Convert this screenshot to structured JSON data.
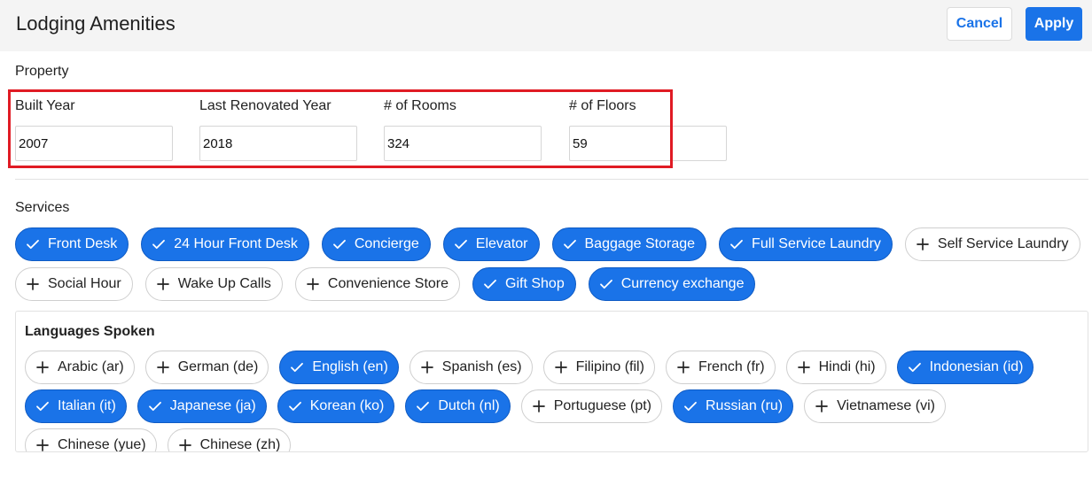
{
  "header": {
    "title": "Lodging Amenities",
    "cancel_label": "Cancel",
    "apply_label": "Apply"
  },
  "property": {
    "section_label": "Property",
    "fields": [
      {
        "label": "Built Year",
        "value": "2007"
      },
      {
        "label": "Last Renovated Year",
        "value": "2018"
      },
      {
        "label": "# of Rooms",
        "value": "324"
      },
      {
        "label": "# of Floors",
        "value": "59"
      }
    ]
  },
  "services": {
    "section_label": "Services",
    "chips": [
      {
        "label": "Front Desk",
        "selected": true
      },
      {
        "label": "24 Hour Front Desk",
        "selected": true
      },
      {
        "label": "Concierge",
        "selected": true
      },
      {
        "label": "Elevator",
        "selected": true
      },
      {
        "label": "Baggage Storage",
        "selected": true
      },
      {
        "label": "Full Service Laundry",
        "selected": true
      },
      {
        "label": "Self Service Laundry",
        "selected": false
      },
      {
        "label": "Social Hour",
        "selected": false
      },
      {
        "label": "Wake Up Calls",
        "selected": false
      },
      {
        "label": "Convenience Store",
        "selected": false
      },
      {
        "label": "Gift Shop",
        "selected": true
      },
      {
        "label": "Currency exchange",
        "selected": true
      }
    ]
  },
  "languages": {
    "section_label": "Languages Spoken",
    "chips": [
      {
        "label": "Arabic (ar)",
        "selected": false
      },
      {
        "label": "German (de)",
        "selected": false
      },
      {
        "label": "English (en)",
        "selected": true
      },
      {
        "label": "Spanish (es)",
        "selected": false
      },
      {
        "label": "Filipino (fil)",
        "selected": false
      },
      {
        "label": "French (fr)",
        "selected": false
      },
      {
        "label": "Hindi (hi)",
        "selected": false
      },
      {
        "label": "Indonesian (id)",
        "selected": true
      },
      {
        "label": "Italian (it)",
        "selected": true
      },
      {
        "label": "Japanese (ja)",
        "selected": true
      },
      {
        "label": "Korean (ko)",
        "selected": true
      },
      {
        "label": "Dutch (nl)",
        "selected": true
      },
      {
        "label": "Portuguese (pt)",
        "selected": false
      },
      {
        "label": "Russian (ru)",
        "selected": true
      },
      {
        "label": "Vietnamese (vi)",
        "selected": false
      },
      {
        "label": "Chinese (yue)",
        "selected": false
      },
      {
        "label": "Chinese (zh)",
        "selected": false
      }
    ]
  },
  "colors": {
    "accent": "#1a73e8",
    "highlight": "#e01b24"
  },
  "icons": {
    "selected": "check-icon",
    "unselected": "plus-icon"
  }
}
